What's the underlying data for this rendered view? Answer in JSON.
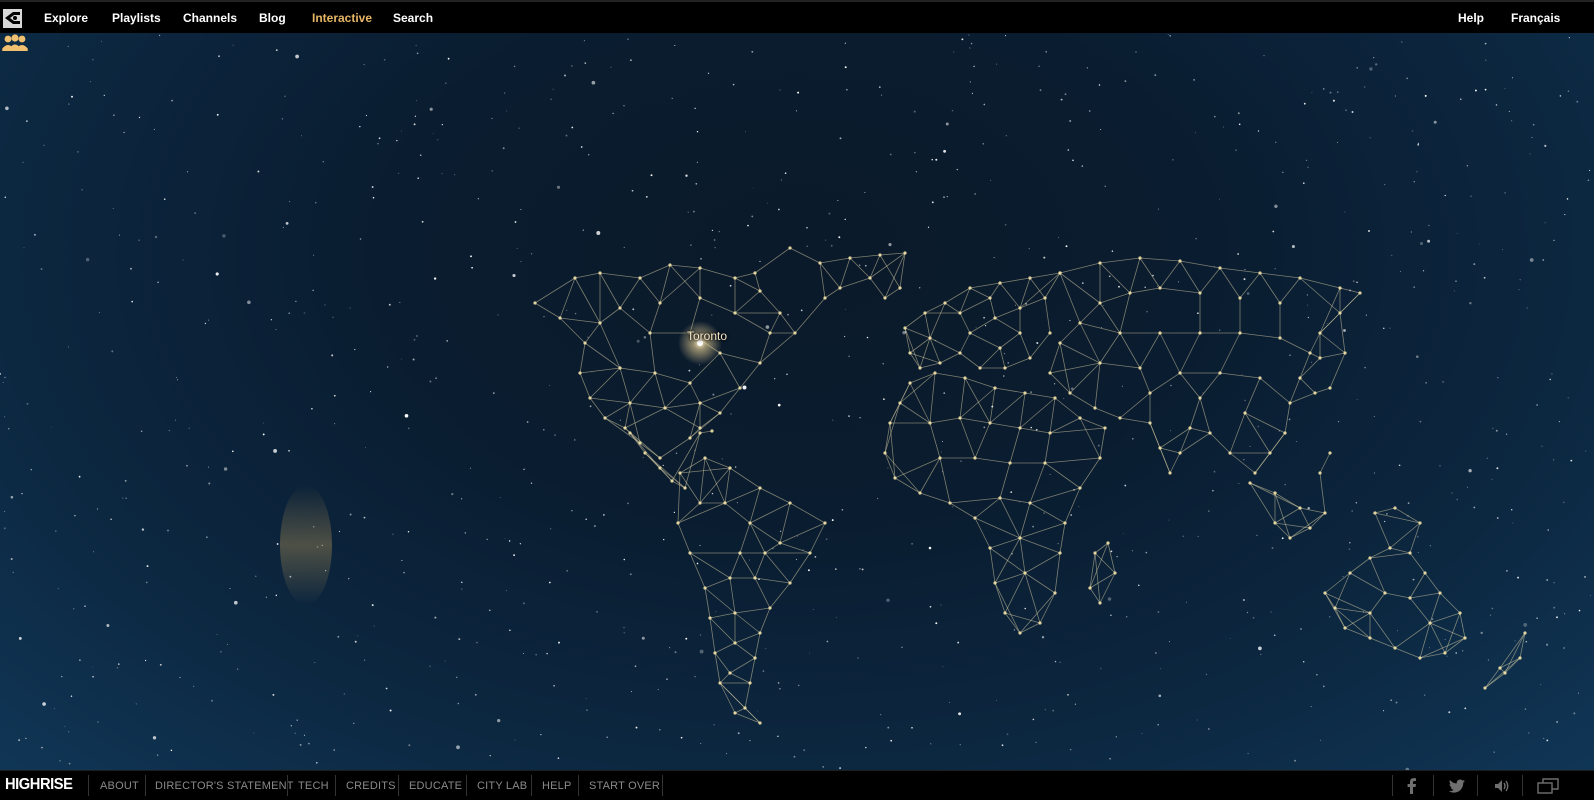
{
  "nav": {
    "logo_icon": "highrise-eye-icon",
    "items": [
      {
        "label": "Explore"
      },
      {
        "label": "Playlists"
      },
      {
        "label": "Channels"
      },
      {
        "label": "Blog"
      },
      {
        "label": "Interactive",
        "active": true
      },
      {
        "label": "Search"
      }
    ],
    "help": "Help",
    "language": "Français",
    "active_color": "#e7b665"
  },
  "map": {
    "city_label": "Toronto",
    "people_icon": "people-group-icon"
  },
  "footer": {
    "brand": "HIGHRISE",
    "links": [
      "ABOUT",
      "DIRECTOR'S STATEMENT",
      "TECH",
      "CREDITS",
      "EDUCATE",
      "CITY LAB",
      "HELP",
      "START OVER"
    ],
    "icons": [
      "facebook-icon",
      "twitter-icon",
      "sound-icon",
      "fullscreen-icon"
    ]
  }
}
